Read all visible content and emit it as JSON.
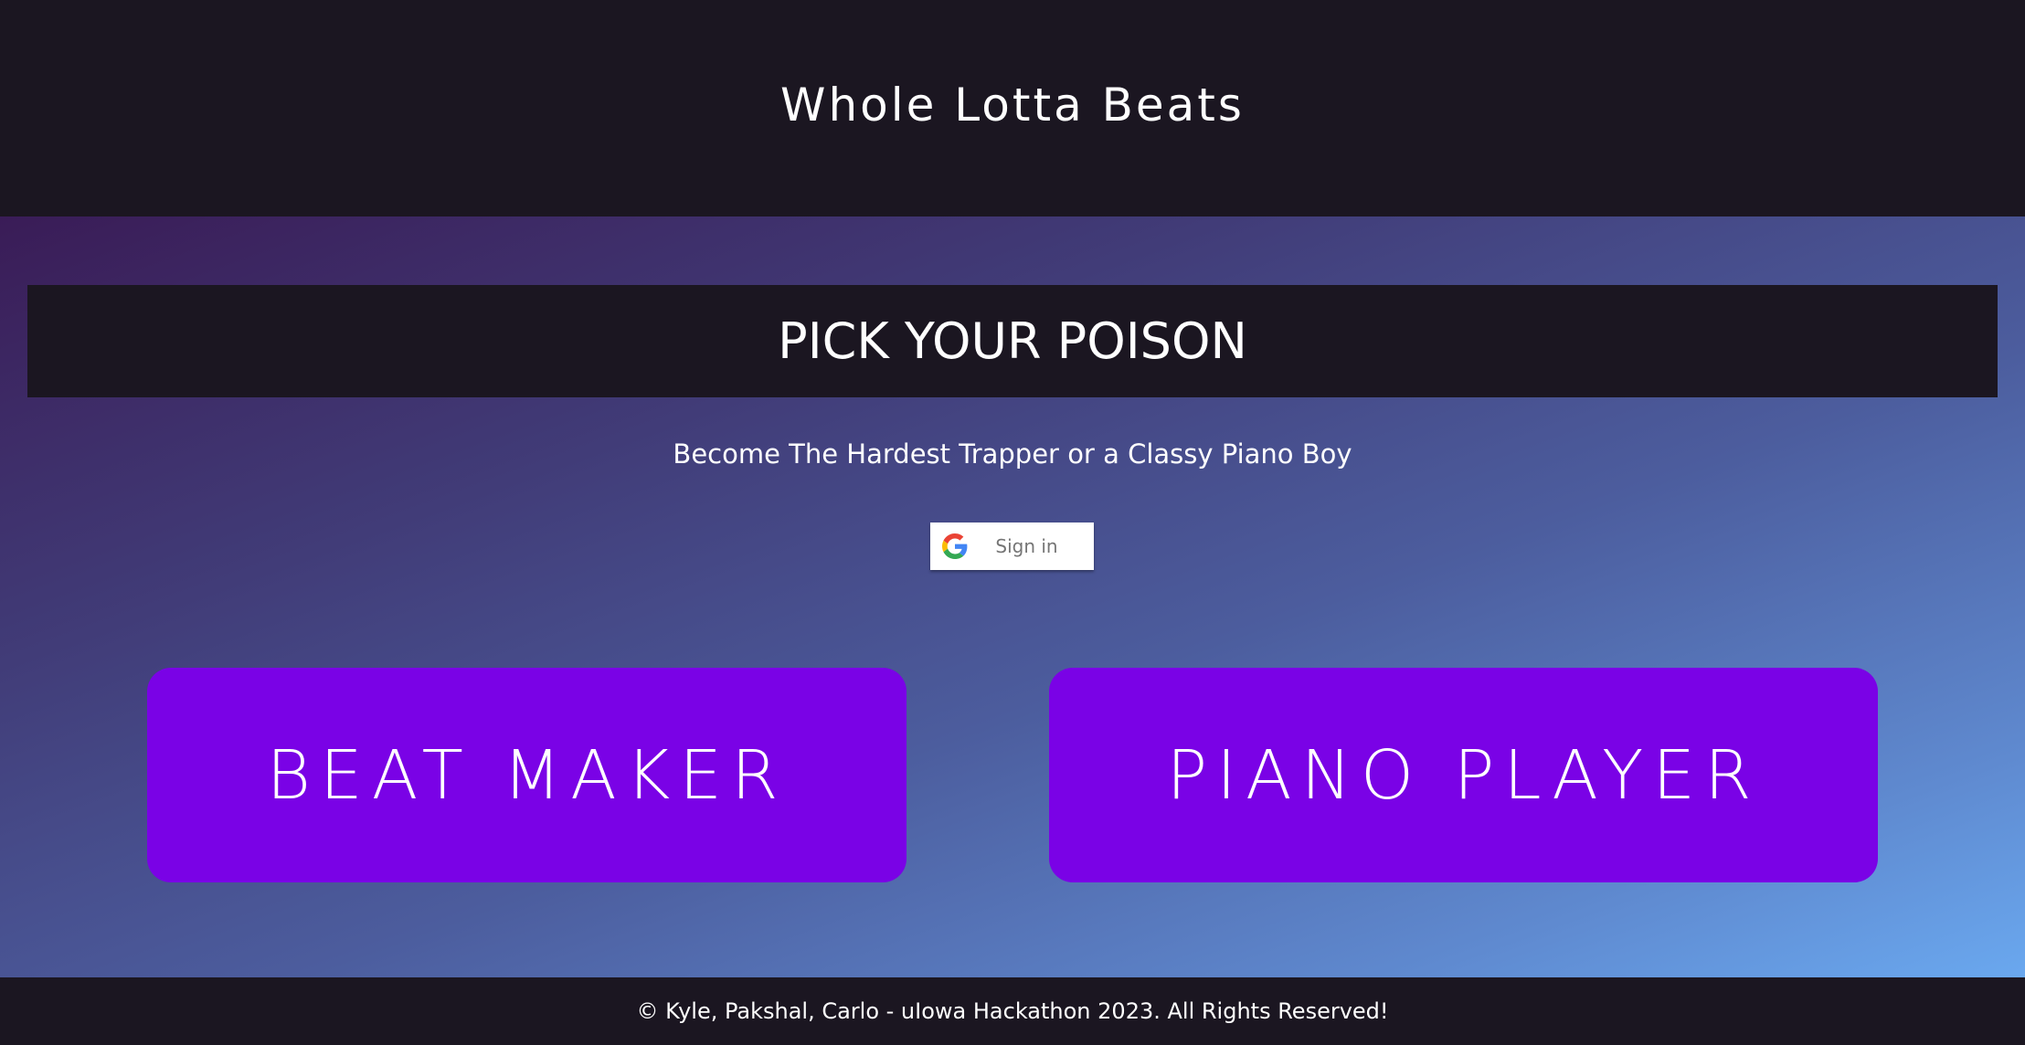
{
  "header": {
    "title": "Whole Lotta Beats"
  },
  "main": {
    "banner_title": "PICK YOUR POISON",
    "subtitle": "Become The Hardest Trapper or a Classy Piano Boy",
    "signin": {
      "label": "Sign in",
      "icon": "google-icon"
    },
    "modes": [
      {
        "label": "BEAT MAKER"
      },
      {
        "label": "PIANO PLAYER"
      }
    ],
    "colors": {
      "dark_bg": "#1b1621",
      "button_purple": "#7a02e6",
      "gradient_start": "#3a1c57",
      "gradient_end": "#6aa8ef"
    }
  },
  "footer": {
    "text": "© Kyle, Pakshal, Carlo - uIowa Hackathon 2023. All Rights Reserved!"
  }
}
